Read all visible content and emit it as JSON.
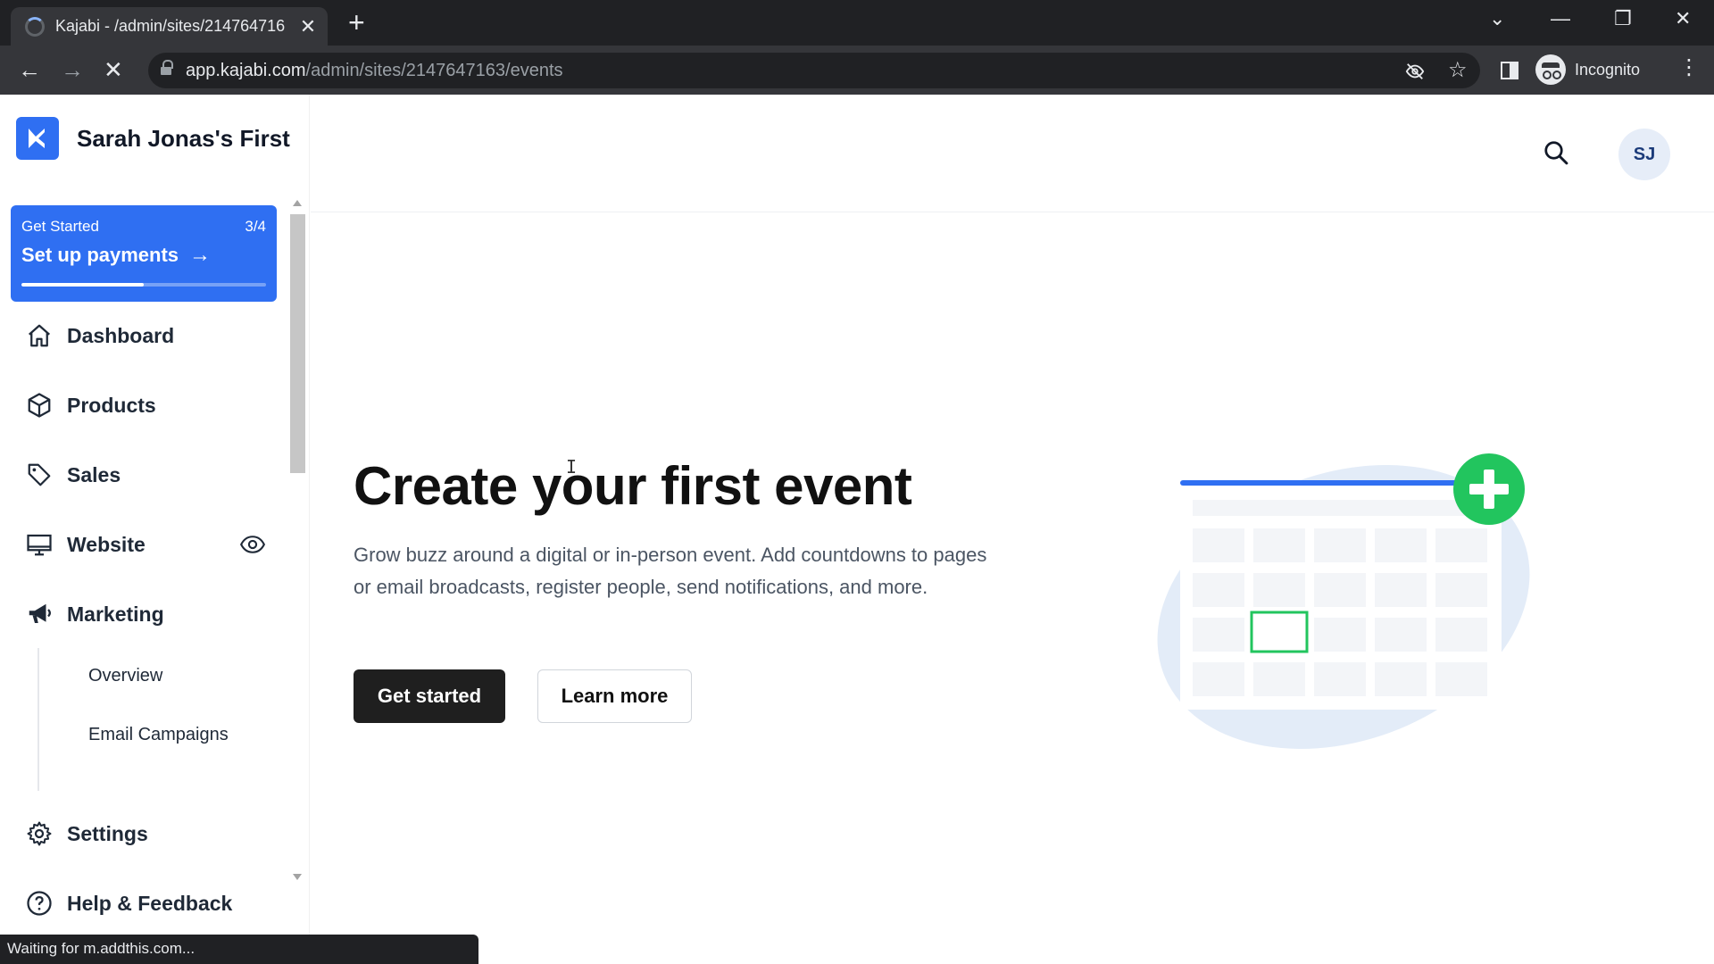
{
  "browser": {
    "tab_title": "Kajabi - /admin/sites/214764716",
    "tab_close": "✕",
    "new_tab": "+",
    "url_host": "app.kajabi.com",
    "url_path": "/admin/sites/2147647163/events",
    "profile_label": "Incognito",
    "status_text": "Waiting for m.addthis.com..."
  },
  "sidebar": {
    "site_name": "Sarah Jonas's First",
    "get_started": {
      "label": "Get Started",
      "progress_text": "3/4",
      "progress_fraction": 0.5,
      "title": "Set up payments",
      "arrow": "→"
    },
    "nav": [
      {
        "label": "Dashboard",
        "icon": "home-icon"
      },
      {
        "label": "Products",
        "icon": "box-icon"
      },
      {
        "label": "Sales",
        "icon": "tag-icon"
      },
      {
        "label": "Website",
        "icon": "monitor-icon"
      },
      {
        "label": "Marketing",
        "icon": "megaphone-icon"
      }
    ],
    "marketing_sub": [
      "Overview",
      "Email Campaigns"
    ],
    "footer_nav": [
      {
        "label": "Settings",
        "icon": "gear-icon"
      },
      {
        "label": "Help & Feedback",
        "icon": "help-icon"
      }
    ]
  },
  "header": {
    "avatar_initials": "SJ"
  },
  "main": {
    "title": "Create your first event",
    "description": "Grow buzz around a digital or in-person event. Add countdowns to pages or email broadcasts, register people, send notifications, and more.",
    "primary_button": "Get started",
    "secondary_button": "Learn more"
  },
  "colors": {
    "brand_blue": "#2f6ff2",
    "accent_green": "#22c55e",
    "dark_button": "#1f1f1f"
  }
}
